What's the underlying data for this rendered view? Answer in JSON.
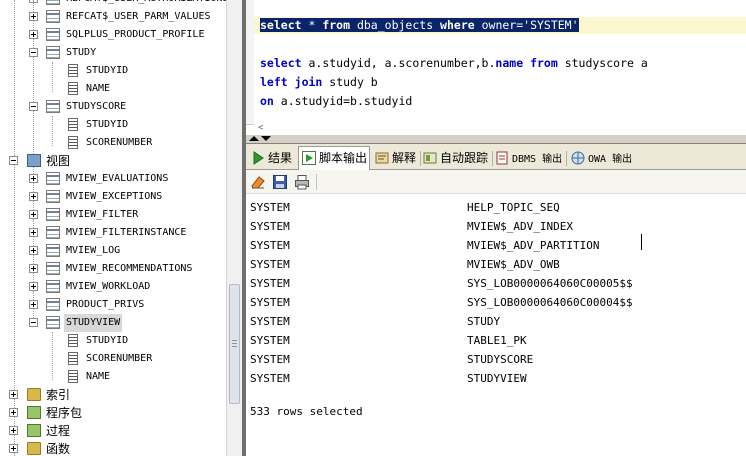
{
  "tree": {
    "top_cut": "REFCAT$_USER_AUTHORIZATIONS",
    "rows": [
      {
        "label": "REFCAT$_USER_PARM_VALUES",
        "kind": "table",
        "expander": "plus"
      },
      {
        "label": "SQLPLUS_PRODUCT_PROFILE",
        "kind": "table",
        "expander": "plus"
      },
      {
        "label": "STUDY",
        "kind": "table",
        "expander": "minus"
      },
      {
        "label": "STUDYID",
        "kind": "column"
      },
      {
        "label": "NAME",
        "kind": "column"
      },
      {
        "label": "STUDYSCORE",
        "kind": "table",
        "expander": "minus"
      },
      {
        "label": "STUDYID",
        "kind": "column"
      },
      {
        "label": "SCORENUMBER",
        "kind": "column"
      },
      {
        "label": "视图",
        "kind": "folder-view",
        "expander": "minus"
      },
      {
        "label": "MVIEW_EVALUATIONS",
        "kind": "table",
        "expander": "plus"
      },
      {
        "label": "MVIEW_EXCEPTIONS",
        "kind": "table",
        "expander": "plus"
      },
      {
        "label": "MVIEW_FILTER",
        "kind": "table",
        "expander": "plus"
      },
      {
        "label": "MVIEW_FILTERINSTANCE",
        "kind": "table",
        "expander": "plus"
      },
      {
        "label": "MVIEW_LOG",
        "kind": "table",
        "expander": "plus"
      },
      {
        "label": "MVIEW_RECOMMENDATIONS",
        "kind": "table",
        "expander": "plus"
      },
      {
        "label": "MVIEW_WORKLOAD",
        "kind": "table",
        "expander": "plus"
      },
      {
        "label": "PRODUCT_PRIVS",
        "kind": "table",
        "expander": "plus"
      },
      {
        "label": "STUDYVIEW",
        "kind": "table",
        "expander": "minus",
        "selected": true
      },
      {
        "label": "STUDYID",
        "kind": "column"
      },
      {
        "label": "SCORENUMBER",
        "kind": "column"
      },
      {
        "label": "NAME",
        "kind": "column"
      },
      {
        "label": "索引",
        "kind": "folder",
        "expander": "plus"
      },
      {
        "label": "程序包",
        "kind": "folder-green",
        "expander": "plus"
      },
      {
        "label": "过程",
        "kind": "folder-green",
        "expander": "plus"
      },
      {
        "label": "函数",
        "kind": "folder",
        "expander": "plus"
      }
    ]
  },
  "editor": {
    "line1": {
      "kw1": "select",
      "mid1": " * ",
      "kw2": "from",
      "mid2": " dba_objects ",
      "kw3": "where",
      "mid3": " owner=",
      "str": "'SYSTEM'"
    },
    "line2": {
      "kw1": "select",
      "t1": " a.studyid, a.scorenumber,b.",
      "kw2": "name",
      "t2": " ",
      "kw3": "from",
      "t3": " studyscore a"
    },
    "line3": {
      "kw1": "left",
      "t1": " ",
      "kw2": "join",
      "t2": " study b"
    },
    "line4": {
      "kw1": "on",
      "t1": " a.studyid=b.studyid"
    }
  },
  "tabs": {
    "results": "结果",
    "script_output": "脚本输出",
    "explain": "解释",
    "autotrace": "自动跟踪",
    "dbms_output": "DBMS 输出",
    "owa_output": "OWA 输出"
  },
  "output": {
    "rows": [
      [
        "SYSTEM",
        "HELP_TOPIC_SEQ"
      ],
      [
        "SYSTEM",
        "MVIEW$_ADV_INDEX"
      ],
      [
        "SYSTEM",
        "MVIEW$_ADV_PARTITION"
      ],
      [
        "SYSTEM",
        "MVIEW$_ADV_OWB"
      ],
      [
        "SYSTEM",
        "SYS_LOB0000064060C00005$$"
      ],
      [
        "SYSTEM",
        "SYS_LOB0000064060C00004$$"
      ],
      [
        "SYSTEM",
        "STUDY"
      ],
      [
        "SYSTEM",
        "TABLE1_PK"
      ],
      [
        "SYSTEM",
        "STUDYSCORE"
      ],
      [
        "SYSTEM",
        "STUDYVIEW"
      ]
    ],
    "summary": "533 rows selected"
  },
  "colors": {
    "keyword": "#0000c8",
    "selection": "#0a246a",
    "current_line": "#fdf7cf"
  }
}
